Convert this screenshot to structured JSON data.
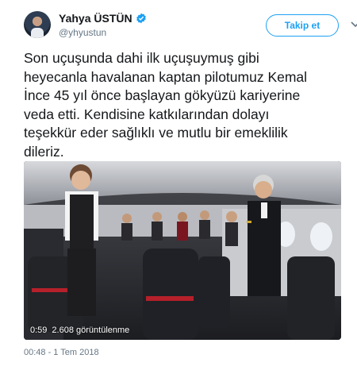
{
  "user": {
    "display_name": "Yahya ÜSTÜN",
    "handle": "@yhyustun",
    "verified_icon": "verified-badge-icon",
    "accent": "#1da1f2"
  },
  "actions": {
    "follow_label": "Takip et",
    "more_icon": "chevron-down-icon"
  },
  "tweet": {
    "text": "Son uçuşunda dahi ilk uçuşuymuş gibi\nheyecanla havalanan kaptan pilotumuz Kemal\nİnce 45 yıl önce başlayan gökyüzü kariyerine\nveda etti. Kendisine katkılarından dolayı\nteşekkür eder sağlıklı ve mutlu bir emeklilik\ndileriz."
  },
  "video": {
    "duration": "0:59",
    "views": "2.608 görüntülenme"
  },
  "timestamp": "00:48 - 1 Tem 2018"
}
